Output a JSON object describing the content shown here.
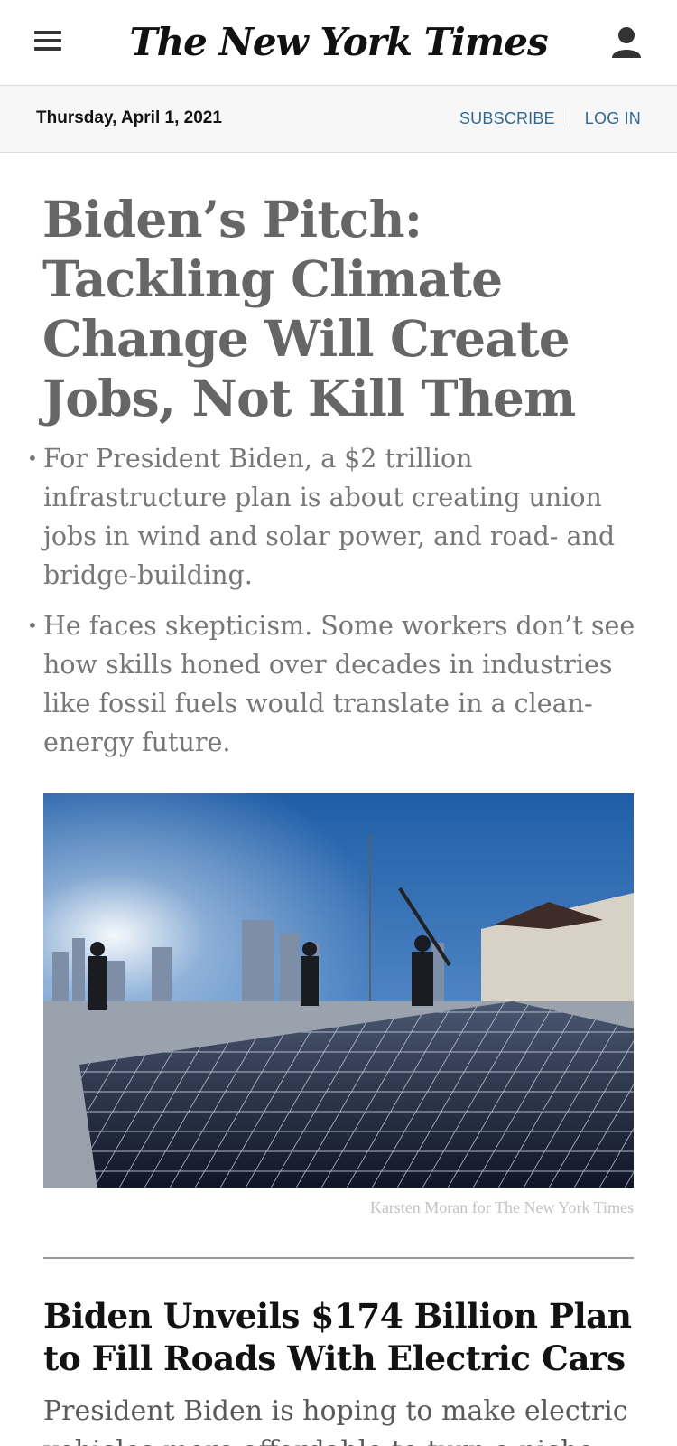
{
  "masthead": {
    "logo_text": "The New York Times",
    "menu_icon": "hamburger-menu-icon",
    "account_icon": "user-icon"
  },
  "datebar": {
    "date": "Thursday, April 1, 2021",
    "subscribe_label": "SUBSCRIBE",
    "login_label": "LOG IN"
  },
  "lead_story": {
    "headline": "Biden’s Pitch: Tackling Climate Change Will Create Jobs, Not Kill Them",
    "bullets": [
      "For President Biden, a $2 trillion infrastructure plan is about creating union jobs in wind and solar power, and road- and bridge-building.",
      "He faces skepticism. Some workers don’t see how skills honed over decades in industries like fossil fuels would translate in a clean-energy future."
    ],
    "image_credit": "Karsten Moran for The New York Times"
  },
  "second_story": {
    "headline": "Biden Unveils $174 Billion Plan to Fill Roads With Electric Cars",
    "summary": "President Biden is hoping to make electric vehicles more affordable to turn a niche"
  },
  "colors": {
    "link": "#326891",
    "headline_gray": "#666666",
    "body_gray": "#777777"
  }
}
